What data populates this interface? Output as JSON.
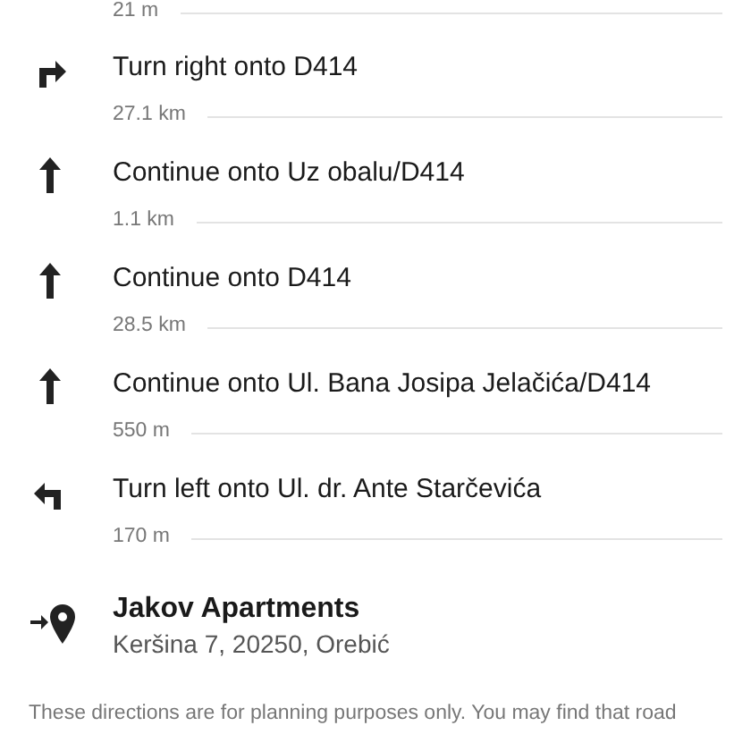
{
  "previous_distance": "21 m",
  "steps": [
    {
      "kind": "turn-right",
      "instruction": "Turn right onto D414",
      "distance": "27.1 km"
    },
    {
      "kind": "straight",
      "instruction": "Continue onto Uz obalu/D414",
      "distance": "1.1 km"
    },
    {
      "kind": "straight",
      "instruction": "Continue onto D414",
      "distance": "28.5 km"
    },
    {
      "kind": "straight",
      "instruction": "Continue onto Ul. Bana Josipa Jelačića/D414",
      "distance": "550 m"
    },
    {
      "kind": "turn-left",
      "instruction": "Turn left onto Ul. dr. Ante Starčevića",
      "distance": "170 m"
    }
  ],
  "destination": {
    "name": "Jakov Apartments",
    "address": "Keršina 7, 20250, Orebić"
  },
  "disclaimer": "These directions are for planning purposes only. You may find that road"
}
